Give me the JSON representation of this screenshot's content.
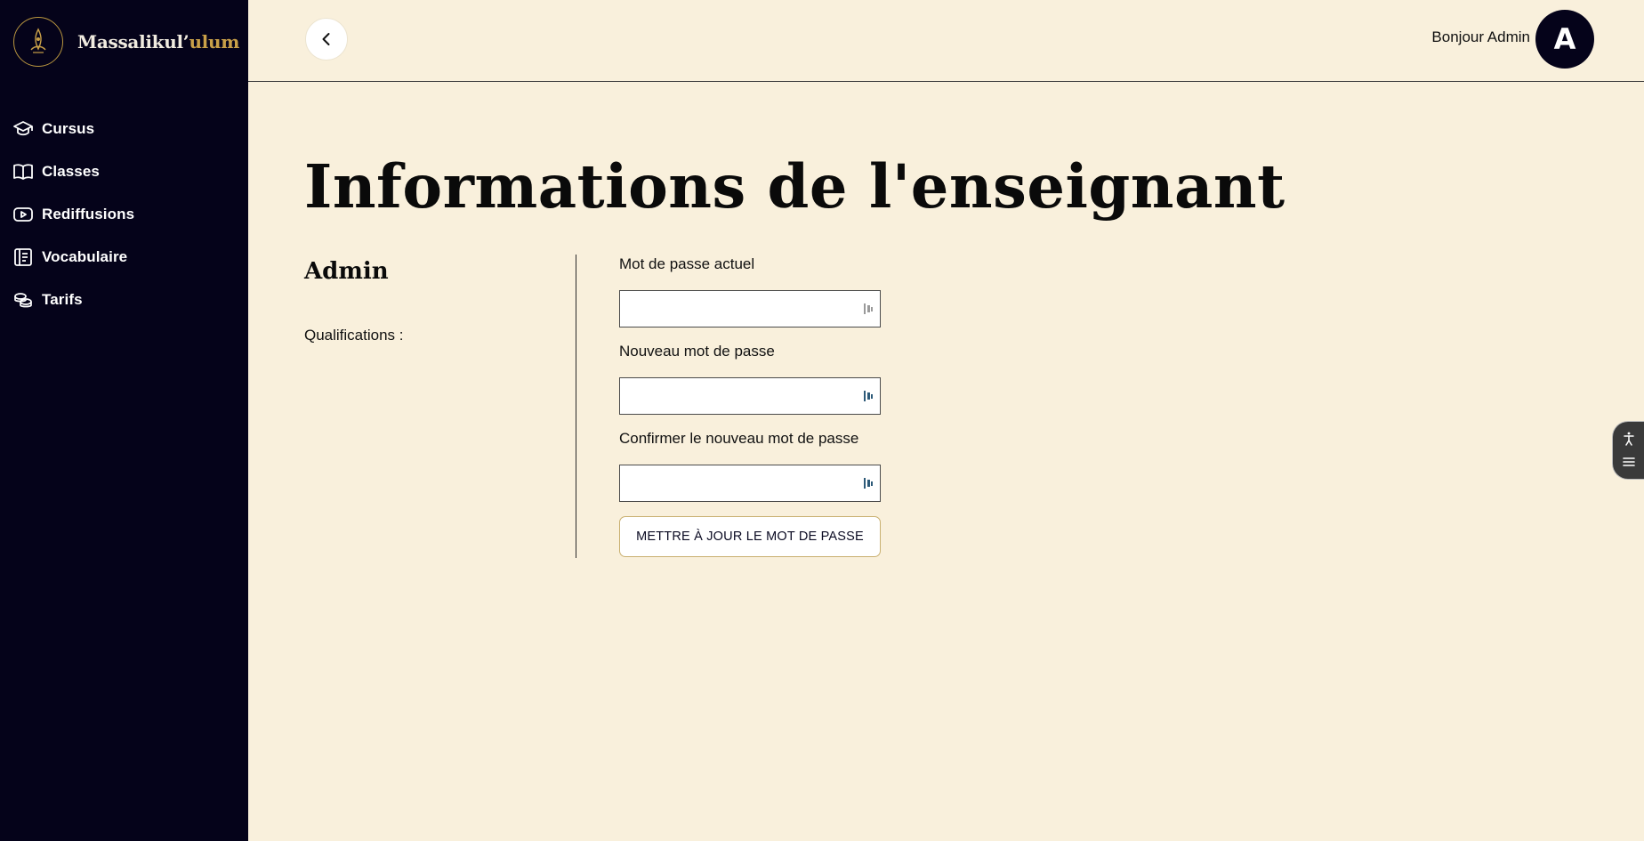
{
  "brand": {
    "name_part1": "Massalikul’",
    "name_part2": "ulum"
  },
  "sidebar": {
    "items": [
      {
        "label": "Cursus",
        "icon": "graduation-cap-icon"
      },
      {
        "label": "Classes",
        "icon": "open-book-icon"
      },
      {
        "label": "Rediffusions",
        "icon": "play-icon"
      },
      {
        "label": "Vocabulaire",
        "icon": "notebook-icon"
      },
      {
        "label": "Tarifs",
        "icon": "coins-icon"
      }
    ]
  },
  "header": {
    "greeting": "Bonjour Admin",
    "avatar_letter": "A"
  },
  "main": {
    "title": "Informations de l'enseignant",
    "profile_name": "Admin",
    "qualifications_label": "Qualifications :"
  },
  "form": {
    "current_password_label": "Mot de passe actuel",
    "current_password_value": "",
    "new_password_label": "Nouveau mot de passe",
    "new_password_value": "",
    "confirm_password_label": "Confirmer le nouveau mot de passe",
    "confirm_password_value": "",
    "submit_label": "METTRE À JOUR LE MOT DE PASSE"
  },
  "colors": {
    "sidebar_bg": "#05031a",
    "page_bg": "#f9f0dc",
    "accent_gold": "#c9a048"
  }
}
